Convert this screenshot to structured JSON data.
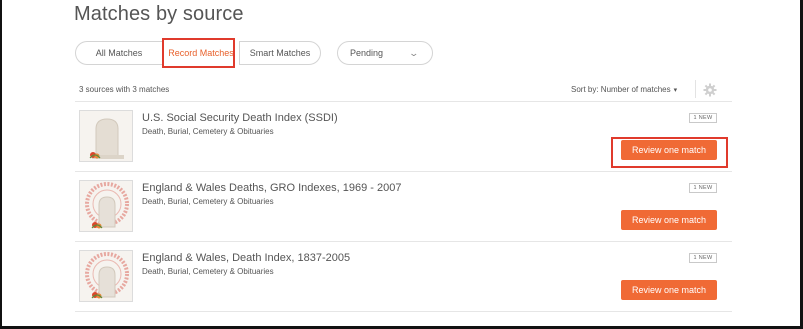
{
  "page": {
    "title": "Matches by source"
  },
  "filters": {
    "tabs": [
      {
        "label": "All Matches"
      },
      {
        "label": "Record Matches"
      },
      {
        "label": "Smart Matches"
      }
    ],
    "active_tab": "Record Matches",
    "status_select": "Pending"
  },
  "summary": {
    "count_text": "3 sources with 3 matches",
    "sort_text": "Sort by: Number of matches"
  },
  "sources": [
    {
      "title": "U.S. Social Security Death Index (SSDI)",
      "category": "Death, Burial, Cemetery & Obituaries",
      "badge": "1 NEW",
      "button": "Review one match",
      "thumb": "gravestone-icon"
    },
    {
      "title": "England & Wales Deaths, GRO Indexes, 1969 - 2007",
      "category": "Death, Burial, Cemetery & Obituaries",
      "badge": "1 NEW",
      "button": "Review one match",
      "thumb": "gravestone-seal-icon"
    },
    {
      "title": "England & Wales, Death Index, 1837-2005",
      "category": "Death, Burial, Cemetery & Obituaries",
      "badge": "1 NEW",
      "button": "Review one match",
      "thumb": "gravestone-seal-icon"
    }
  ],
  "colors": {
    "accent": "#f06a35",
    "highlight": "#e03a2c"
  }
}
